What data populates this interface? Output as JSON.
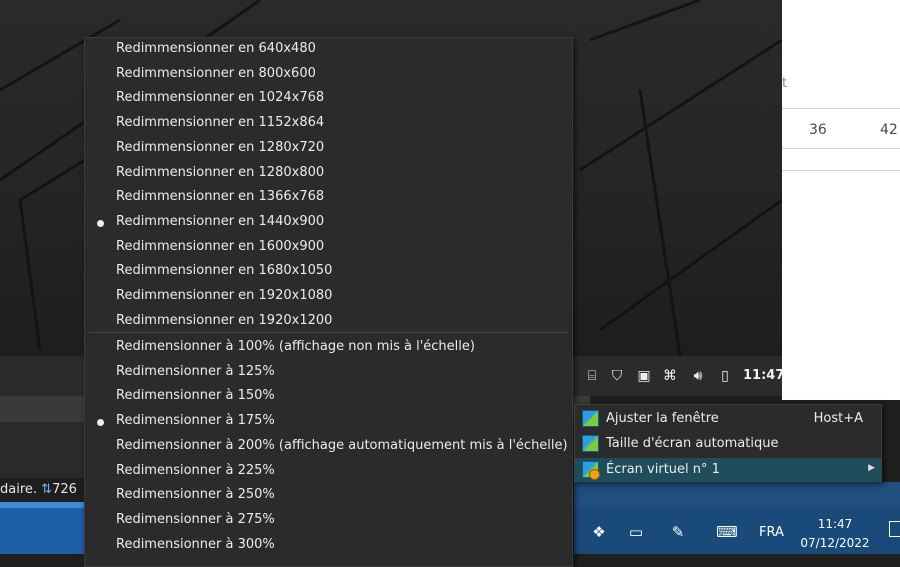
{
  "resize_menu": {
    "fixed_items": [
      {
        "label": "Redimmensionner en 640x480",
        "selected": false
      },
      {
        "label": "Redimmensionner en 800x600",
        "selected": false
      },
      {
        "label": "Redimmensionner en 1024x768",
        "selected": false
      },
      {
        "label": "Redimmensionner en 1152x864",
        "selected": false
      },
      {
        "label": "Redimmensionner en 1280x720",
        "selected": false
      },
      {
        "label": "Redimmensionner en 1280x800",
        "selected": false
      },
      {
        "label": "Redimmensionner en 1366x768",
        "selected": false
      },
      {
        "label": "Redimmensionner en 1440x900",
        "selected": true
      },
      {
        "label": "Redimmensionner en 1600x900",
        "selected": false
      },
      {
        "label": "Redimmensionner en 1680x1050",
        "selected": false
      },
      {
        "label": "Redimmensionner en 1920x1080",
        "selected": false
      },
      {
        "label": "Redimmensionner en 1920x1200",
        "selected": false
      }
    ],
    "scale_items": [
      {
        "label": "Redimensionner à 100% (affichage non mis à l'échelle)",
        "selected": false
      },
      {
        "label": "Redimensionner à 125%",
        "selected": false
      },
      {
        "label": "Redimensionner à 150%",
        "selected": false
      },
      {
        "label": "Redimensionner à 175%",
        "selected": true
      },
      {
        "label": "Redimensionner à 200% (affichage automatiquement mis à l'échelle)",
        "selected": false
      },
      {
        "label": "Redimensionner à 225%",
        "selected": false
      },
      {
        "label": "Redimensionner à 250%",
        "selected": false
      },
      {
        "label": "Redimensionner à 275%",
        "selected": false
      },
      {
        "label": "Redimensionner à 300%",
        "selected": false
      }
    ]
  },
  "vbox_menu": {
    "items": [
      {
        "label": "Ajuster la fenêtre",
        "shortcut": "Host+A",
        "icon": "fit-window-icon"
      },
      {
        "label": "Taille d'écran automatique",
        "shortcut": "",
        "icon": "auto-resize-icon"
      },
      {
        "label": "Écran virtuel n° 1",
        "shortcut": "",
        "icon": "virtual-screen-icon",
        "submenu": true
      }
    ]
  },
  "guest_tray": {
    "clock": "11:47"
  },
  "white_app": {
    "partial_text": "t",
    "cells": [
      "36",
      "42"
    ]
  },
  "left_status": {
    "text": "daire.",
    "count": "726"
  },
  "host_taskbar": {
    "language": "FRA",
    "time": "11:47",
    "date": "07/12/2022"
  }
}
